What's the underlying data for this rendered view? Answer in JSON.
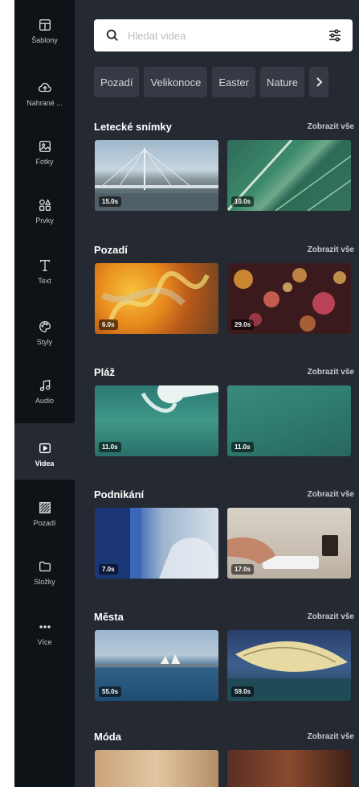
{
  "sidebar": {
    "items": [
      {
        "label": "Šablony",
        "icon": "templates-icon",
        "active": false
      },
      {
        "label": "Nahrané ...",
        "icon": "upload-cloud-icon",
        "active": false
      },
      {
        "label": "Fotky",
        "icon": "photo-icon",
        "active": false
      },
      {
        "label": "Prvky",
        "icon": "elements-icon",
        "active": false
      },
      {
        "label": "Text",
        "icon": "text-icon",
        "active": false
      },
      {
        "label": "Styly",
        "icon": "palette-icon",
        "active": false
      },
      {
        "label": "Audio",
        "icon": "music-note-icon",
        "active": false
      },
      {
        "label": "Videa",
        "icon": "video-icon",
        "active": true
      },
      {
        "label": "Pozadí",
        "icon": "background-pattern-icon",
        "active": false
      },
      {
        "label": "Složky",
        "icon": "folder-icon",
        "active": false
      },
      {
        "label": "Více",
        "icon": "more-dots-icon",
        "active": false
      }
    ]
  },
  "search": {
    "placeholder": "Hledat videa",
    "value": "",
    "icon": "search-icon",
    "filter_icon": "filter-sliders-icon"
  },
  "chips": [
    "Pozadí",
    "Velikonoce",
    "Easter",
    "Nature"
  ],
  "chips_next_icon": "chevron-right-icon",
  "sections": [
    {
      "title": "Letecké snímky",
      "link": "Zobrazit vše",
      "videos": [
        {
          "duration": "15.0s"
        },
        {
          "duration": "10.0s"
        }
      ]
    },
    {
      "title": "Pozadí",
      "link": "Zobrazit vše",
      "videos": [
        {
          "duration": "6.0s"
        },
        {
          "duration": "29.0s"
        }
      ]
    },
    {
      "title": "Pláž",
      "link": "Zobrazit vše",
      "videos": [
        {
          "duration": "11.0s"
        },
        {
          "duration": "11.0s"
        }
      ]
    },
    {
      "title": "Podnikání",
      "link": "Zobrazit vše",
      "videos": [
        {
          "duration": "7.0s"
        },
        {
          "duration": "17.0s"
        }
      ]
    },
    {
      "title": "Města",
      "link": "Zobrazit vše",
      "videos": [
        {
          "duration": "55.0s"
        },
        {
          "duration": "59.0s"
        }
      ]
    },
    {
      "title": "Móda",
      "link": "Zobrazit vše",
      "videos": [
        {
          "duration": ""
        },
        {
          "duration": ""
        }
      ]
    }
  ],
  "colors": {
    "sidebar_bg": "#0e1318",
    "panel_bg": "#252932",
    "active_item_bg": "#252932",
    "chip_bg": "#353a44"
  }
}
